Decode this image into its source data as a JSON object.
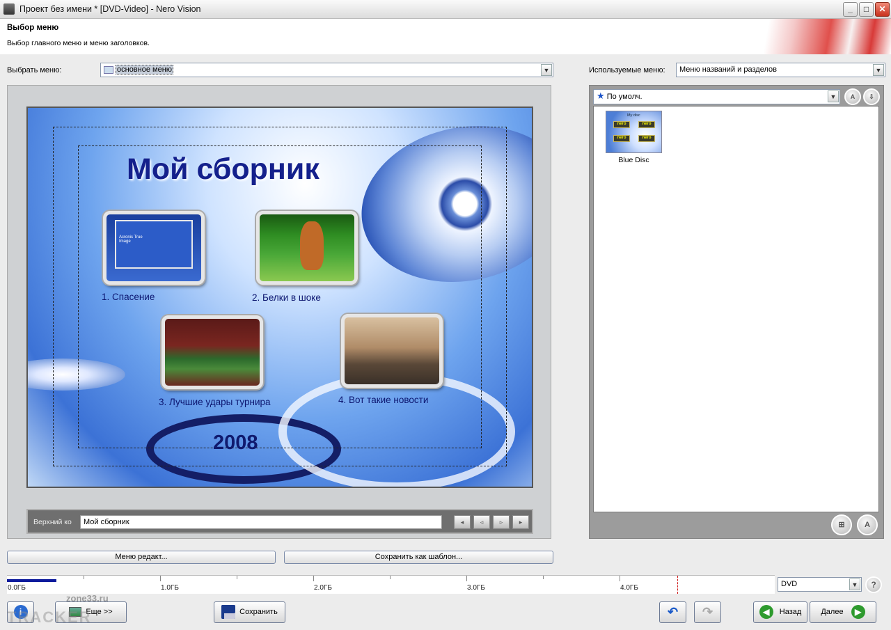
{
  "window": {
    "title": "Проект без имени * [DVD-Video] - Nero Vision",
    "minimize": "_",
    "maximize": "□",
    "close": "✕"
  },
  "header": {
    "title": "Выбор меню",
    "subtitle": "Выбор главного меню и меню заголовков."
  },
  "select_menu": {
    "label": "Выбрать меню:",
    "value": "основное меню"
  },
  "used_menus": {
    "label": "Используемые меню:",
    "value": "Меню названий и разделов"
  },
  "preset": {
    "value": "По умолч."
  },
  "templates": [
    {
      "name": "Blue Disc",
      "thumb_text": "My disc",
      "thumb_buttons": [
        "nero",
        "nero",
        "nero",
        "nero"
      ]
    }
  ],
  "menu_preview": {
    "title": "Мой сборник",
    "year": "2008",
    "items": [
      {
        "caption": "1. Спасение"
      },
      {
        "caption": "2. Белки в шоке"
      },
      {
        "caption": "3. Лучшие удары турнира"
      },
      {
        "caption": "4. Вот такие новости"
      }
    ],
    "thumb1_text": "Acronis True Image"
  },
  "caption_editor": {
    "label": "Верхний ко",
    "value": "Мой сборник"
  },
  "buttons": {
    "edit_menu": "Меню редакт...",
    "save_template": "Сохранить как шаблон...",
    "more": "Еще >>",
    "save": "Сохранить",
    "back": "Назад",
    "next": "Далее"
  },
  "capacity": {
    "ticks": [
      "0.0ГБ",
      "1.0ГБ",
      "2.0ГБ",
      "3.0ГБ",
      "4.0ГБ"
    ],
    "used_fraction": 0.015,
    "disc_type": "DVD"
  },
  "watermark": {
    "line1": "zone33.ru",
    "line2": "TRACKER"
  },
  "colors": {
    "accent": "#0d1a9c",
    "title_text": "#14208c",
    "preview_border": "#565656"
  }
}
